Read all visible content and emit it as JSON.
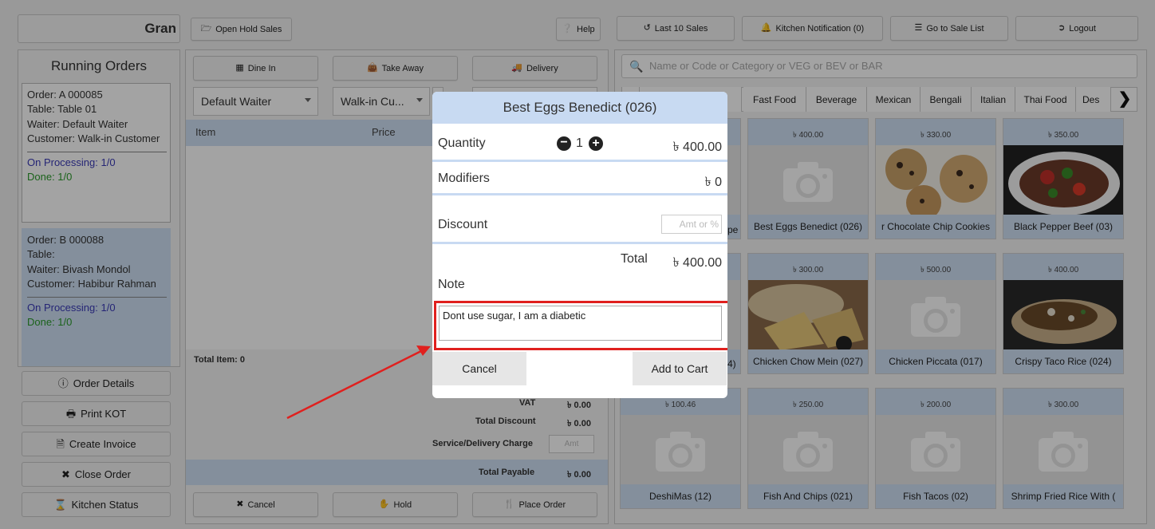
{
  "top": {
    "grand_input": "Gran",
    "open_hold_sales": "Open Hold Sales",
    "help": "Help",
    "last10": "Last 10 Sales",
    "kitchen_notification": "Kitchen Notification (0)",
    "go_sale_list": "Go to Sale List",
    "logout": "Logout"
  },
  "left": {
    "title": "Running Orders",
    "orders": [
      {
        "order": "Order: A 000085",
        "table": "Table: Table 01",
        "waiter": "Waiter: Default Waiter",
        "customer": "Customer: Walk-in Customer",
        "processing": "On Processing: 1/0",
        "done": "Done: 1/0"
      },
      {
        "order": "Order: B 000088",
        "table": "Table:",
        "waiter": "Waiter: Bivash Mondol",
        "customer": "Customer: Habibur Rahman",
        "processing": "On Processing: 1/0",
        "done": "Done: 1/0"
      }
    ],
    "buttons": {
      "order_details": "Order Details",
      "print_kot": "Print KOT",
      "create_invoice": "Create Invoice",
      "close_order": "Close Order",
      "kitchen_status": "Kitchen Status"
    }
  },
  "middle": {
    "dine_in": "Dine In",
    "take_away": "Take Away",
    "delivery": "Delivery",
    "waiter_select": "Default Waiter",
    "customer_select": "Walk-in Cu...",
    "col_item": "Item",
    "col_price": "Price",
    "total_item": "Total Item: 0",
    "vat_label": "VAT",
    "vat_value": "৳ 0.00",
    "discount_label": "Total Discount",
    "discount_value": "৳ 0.00",
    "service_label": "Service/Delivery Charge",
    "service_placeholder": "Amt",
    "payable_label": "Total Payable",
    "payable_value": "৳ 0.00",
    "cancel": "Cancel",
    "hold": "Hold",
    "place_order": "Place Order"
  },
  "right": {
    "search_placeholder": "Name or Code or Category or VEG or BEV or BAR",
    "categories": [
      "A",
      "",
      "Fast Food",
      "Beverage",
      "Mexican",
      "Bengali",
      "Italian",
      "Thai Food",
      "Des"
    ],
    "items": [
      {
        "price": "",
        "name": "",
        "photo": "camera"
      },
      {
        "price": "৳ 400.00",
        "name": "Best Eggs Benedict (026)",
        "photo": "camera"
      },
      {
        "price": "৳ 330.00",
        "name": "r Chocolate Chip Cookies",
        "photo": "cookies"
      },
      {
        "price": "৳ 350.00",
        "name": "Black Pepper Beef (03)",
        "photo": "beef"
      },
      {
        "price": "",
        "name": "",
        "photo": "camera"
      },
      {
        "price": "৳ 300.00",
        "name": "Chicken Chow Mein (027)",
        "photo": "chowmein"
      },
      {
        "price": "৳ 500.00",
        "name": "Chicken Piccata (017)",
        "photo": "camera"
      },
      {
        "price": "৳ 400.00",
        "name": "Crispy Taco Rice (024)",
        "photo": "taco"
      },
      {
        "price": "৳ 100.46",
        "name": "DeshiMas (12)",
        "photo": "camera"
      },
      {
        "price": "৳ 250.00",
        "name": "Fish And Chips (021)",
        "photo": "camera"
      },
      {
        "price": "৳ 200.00",
        "name": "Fish Tacos (02)",
        "photo": "camera"
      },
      {
        "price": "৳ 300.00",
        "name": "Shrimp Fried Rice With (",
        "photo": "camera"
      }
    ],
    "partial_under_modal_1": "pe",
    "partial_under_modal_2": "4)"
  },
  "modal": {
    "title": "Best Eggs Benedict (026)",
    "quantity_label": "Quantity",
    "quantity_value": "1",
    "quantity_price": "৳ 400.00",
    "modifiers_label": "Modifiers",
    "modifiers_value": "৳ 0",
    "discount_label": "Discount",
    "discount_placeholder": "Amt or %",
    "total_label": "Total",
    "total_value": "৳ 400.00",
    "note_label": "Note",
    "note_value": "Dont use sugar, I am a diabetic",
    "cancel": "Cancel",
    "add_to_cart": "Add to Cart"
  },
  "colors": {
    "highlight": "#e0201e",
    "accent": "#cfe0f5",
    "overlay": "rgba(0,0,0,0.36)"
  }
}
